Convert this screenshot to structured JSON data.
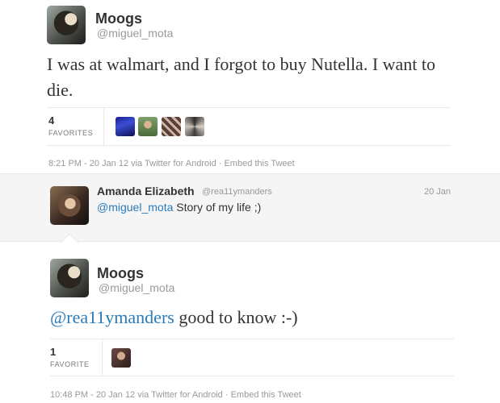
{
  "tweet1": {
    "fullname": "Moogs",
    "username": "@miguel_mota",
    "text": "I was at walmart, and I forgot to buy Nutella. I want to die.",
    "favorites_count": "4",
    "favorites_label": "FAVORITES",
    "timestamp": "8:21 PM - 20 Jan 12 via Twitter for Android",
    "separator": " · ",
    "embed_label": "Embed this Tweet"
  },
  "reply": {
    "fullname": "Amanda Elizabeth",
    "username": "@rea11ymanders",
    "time": "20 Jan",
    "mention": "@miguel_mota",
    "text": " Story of my life ;)"
  },
  "tweet2": {
    "fullname": "Moogs",
    "username": "@miguel_mota",
    "mention": "@rea11ymanders",
    "text": " good to know :-)",
    "favorites_count": "1",
    "favorites_label": "FAVORITE",
    "timestamp": "10:48 PM - 20 Jan 12 via Twitter for Android",
    "separator": " · ",
    "embed_label": "Embed this Tweet"
  },
  "icons": {
    "avatar1": "user-avatar",
    "avatar2": "user-avatar",
    "favoriter": "favoriter-avatar"
  }
}
